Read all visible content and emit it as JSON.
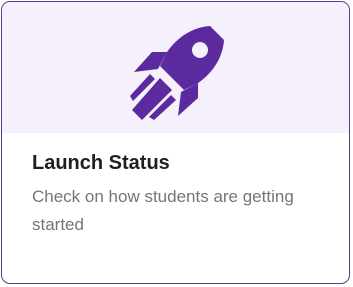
{
  "card": {
    "icon": "rocket-icon",
    "title": "Launch Status",
    "description": "Check on how students are getting started"
  },
  "colors": {
    "accent": "#5a2a9e",
    "border": "#5b3a8e",
    "hero_background": "#f5f0fb",
    "title": "#1f1f1f",
    "description": "#757575"
  }
}
